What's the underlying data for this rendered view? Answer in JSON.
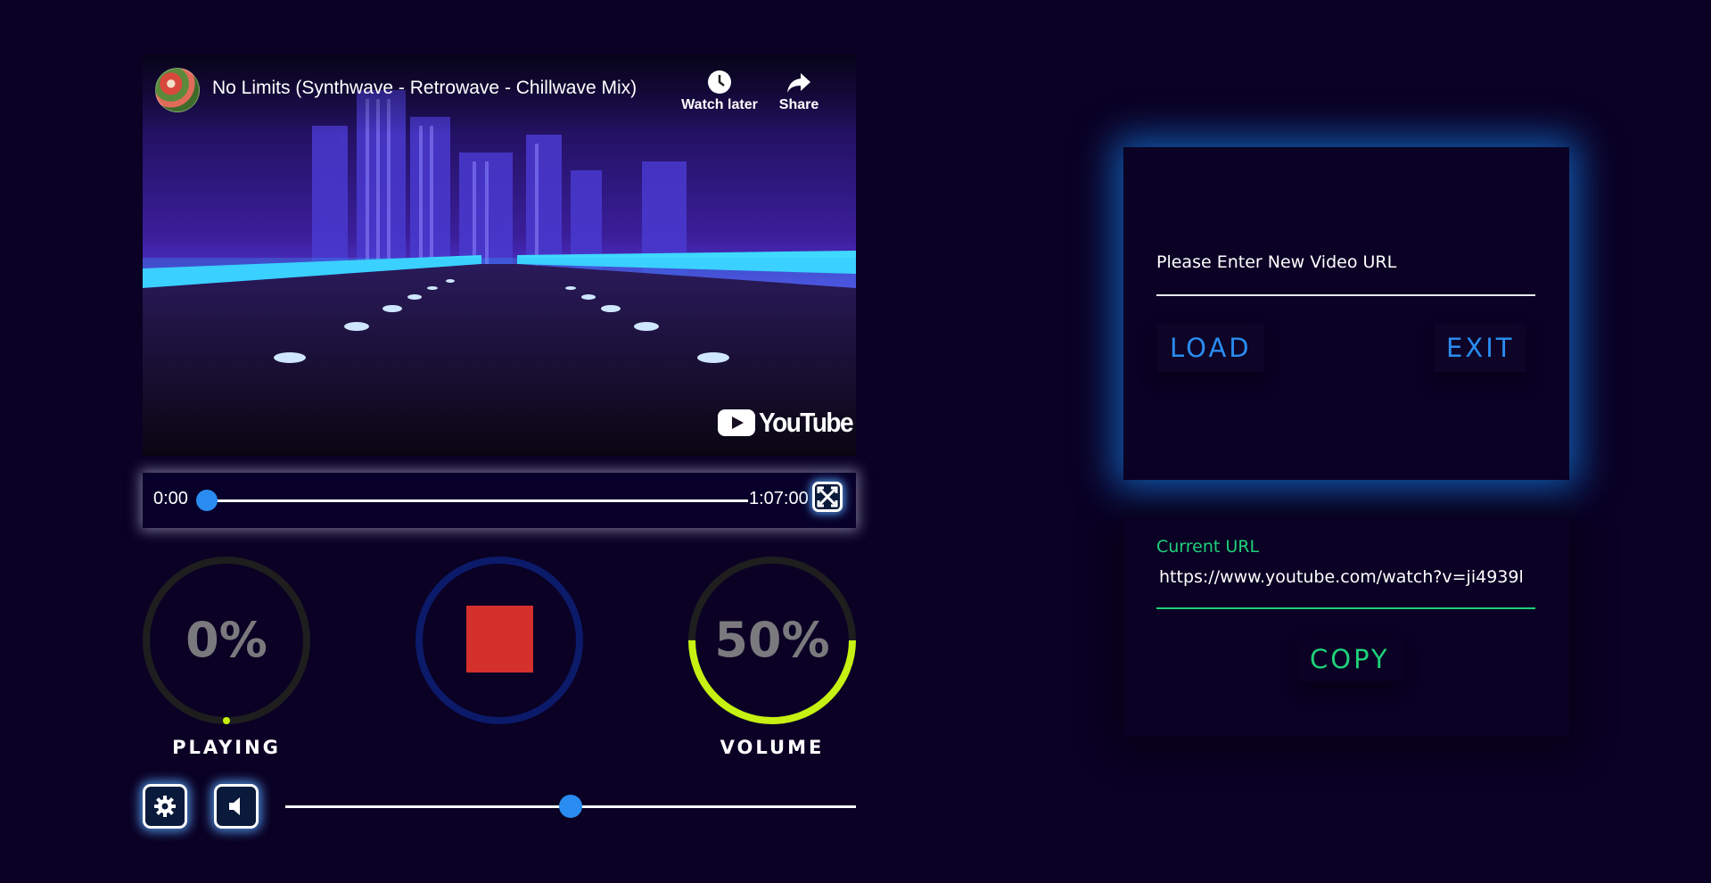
{
  "video": {
    "title": "No Limits (Synthwave - Retrowave - Chillwave Mix)",
    "watch_later_label": "Watch later",
    "share_label": "Share",
    "brand": "YouTube"
  },
  "progress": {
    "current_time": "0:00",
    "total_time": "1:07:00",
    "fraction": 0
  },
  "dials": {
    "playing": {
      "value_text": "0%",
      "label": "PLAYING",
      "fraction": 0
    },
    "volume": {
      "value_text": "50%",
      "label": "VOLUME",
      "fraction": 0.5
    }
  },
  "volume_slider": {
    "fraction": 0.5
  },
  "url_panel": {
    "input_label": "Please Enter New Video URL",
    "load_label": "LOAD",
    "exit_label": "EXIT"
  },
  "current_url": {
    "label": "Current URL",
    "value": "https://www.youtube.com/watch?v=ji4939l",
    "copy_label": "COPY"
  },
  "colors": {
    "background": "#0a0124",
    "accent_blue": "#2a8cf0",
    "accent_green": "#1fd17a",
    "volume_ring": "#c6f112",
    "stop_red": "#d4302c",
    "stop_ring": "#0c1a6a",
    "dial_track": "#1e1e1e"
  },
  "icons": {
    "watch_later": "clock-icon",
    "share": "share-arrow-icon",
    "fullscreen": "expand-icon",
    "settings": "gear-icon",
    "mute": "speaker-icon"
  }
}
